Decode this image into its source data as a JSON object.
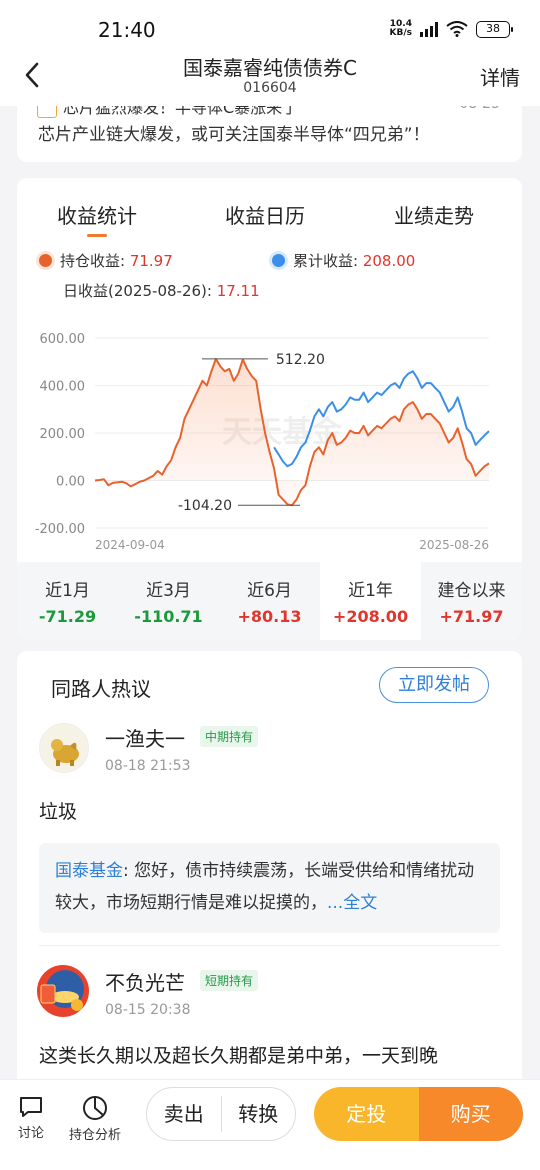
{
  "status_bar": {
    "time": "21:40",
    "net_speed_top": "10.4",
    "net_speed_bottom": "KB/s",
    "battery": "38"
  },
  "header": {
    "title": "国泰嘉睿纯债债券C",
    "code": "016604",
    "detail_label": "详情"
  },
  "news": {
    "partial_title": "芯片猛烈爆发！半导体C暴涨来了",
    "partial_date": "08-25",
    "text": "芯片产业链大爆发，或可关注国泰半导体“四兄弟”！"
  },
  "tabs": [
    "收益统计",
    "收益日历",
    "业绩走势"
  ],
  "legend": {
    "holding_label": "持仓收益: ",
    "holding_value": "71.97",
    "holding_color": "#e8622d",
    "cumulative_label": "累计收益: ",
    "cumulative_value": "208.00",
    "cumulative_color": "#3b8fe8",
    "daily_label": "日收益(2025-08-26): ",
    "daily_value": "17.11"
  },
  "chart_data": {
    "type": "line",
    "x": [
      "2024-09-04",
      "2025-08-26"
    ],
    "ylim": [
      -200,
      600
    ],
    "yticks": [
      "600.00",
      "400.00",
      "200.00",
      "0.00",
      "-200.00"
    ],
    "xtick_labels": [
      "2024-09-04",
      "2025-08-26"
    ],
    "annotations": {
      "max": "512.20",
      "min": "-104.20"
    },
    "watermark": "天天基金",
    "series": [
      {
        "color": "#e8622d",
        "values": [
          0,
          2,
          5,
          -20,
          -10,
          -8,
          -5,
          -12,
          -25,
          -15,
          -5,
          0,
          10,
          20,
          40,
          25,
          60,
          85,
          140,
          180,
          260,
          300,
          340,
          380,
          420,
          400,
          460,
          512,
          480,
          460,
          470,
          420,
          450,
          510,
          470,
          440,
          420,
          300,
          200,
          120,
          50,
          -60,
          -80,
          -100,
          -104,
          -80,
          -40,
          -20,
          60,
          120,
          140,
          110,
          170,
          200,
          150,
          160,
          180,
          210,
          200,
          200,
          230,
          190,
          210,
          230,
          220,
          240,
          260,
          270,
          250,
          300,
          320,
          330,
          300,
          260,
          280,
          280,
          260,
          240,
          200,
          160,
          180,
          220,
          160,
          90,
          70,
          20,
          40,
          60,
          72
        ]
      },
      {
        "color": "#3b8fe8",
        "values": [
          null,
          null,
          null,
          null,
          null,
          null,
          null,
          null,
          null,
          null,
          null,
          null,
          null,
          null,
          null,
          null,
          null,
          null,
          null,
          null,
          null,
          null,
          null,
          null,
          null,
          null,
          null,
          null,
          null,
          null,
          null,
          null,
          null,
          null,
          null,
          null,
          null,
          null,
          null,
          null,
          140,
          110,
          80,
          60,
          70,
          100,
          140,
          160,
          210,
          270,
          300,
          270,
          310,
          330,
          290,
          300,
          320,
          350,
          340,
          340,
          370,
          330,
          350,
          370,
          360,
          380,
          400,
          410,
          390,
          430,
          450,
          460,
          430,
          390,
          410,
          410,
          390,
          370,
          330,
          290,
          310,
          350,
          290,
          220,
          200,
          150,
          170,
          190,
          208
        ]
      }
    ]
  },
  "periods": [
    {
      "label": "近1月",
      "value": "-71.29",
      "sign": "neg"
    },
    {
      "label": "近3月",
      "value": "-110.71",
      "sign": "neg"
    },
    {
      "label": "近6月",
      "value": "+80.13",
      "sign": "pos"
    },
    {
      "label": "近1年",
      "value": "+208.00",
      "sign": "pos",
      "active": true
    },
    {
      "label": "建仓以来",
      "value": "+71.97",
      "sign": "pos"
    }
  ],
  "discussion": {
    "title": "同路人热议",
    "post_button": "立即发帖",
    "posts": [
      {
        "user": "一渔夫一",
        "tag": "中期持有",
        "time": "08-18 21:53",
        "content": "垃圾",
        "reply_who": "国泰基金",
        "reply_text": ": 您好，债市持续震荡，长端受供给和情绪扰动较大，市场短期行情是难以捉摸的，",
        "reply_more": "...全文"
      },
      {
        "user": "不负光芒",
        "tag": "短期持有",
        "time": "08-15 20:38",
        "content": "这类长久期以及超长久期都是弟中弟，一天到晚"
      }
    ]
  },
  "bottom_bar": {
    "discuss_label": "讨论",
    "analysis_label": "持仓分析",
    "sell_label": "卖出",
    "convert_label": "转换",
    "fixed_label": "定投",
    "buy_label": "购买"
  }
}
